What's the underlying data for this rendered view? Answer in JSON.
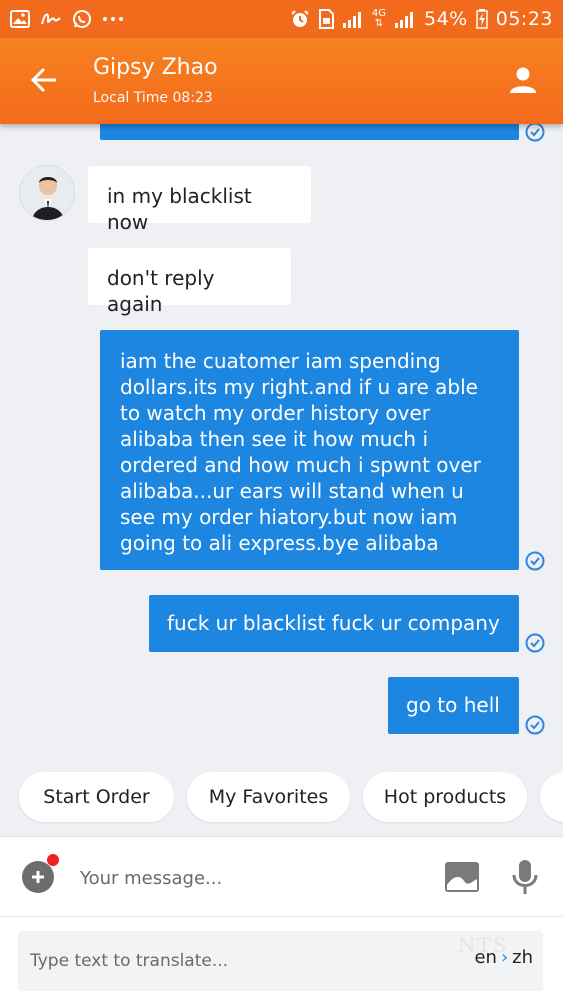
{
  "status_bar": {
    "network": "4G",
    "battery": "54%",
    "time": "05:23"
  },
  "header": {
    "contact_name": "Gipsy Zhao",
    "local_time": "Local Time 08:23"
  },
  "messages": [
    {
      "side": "incoming",
      "text": "in my blacklist now"
    },
    {
      "side": "incoming",
      "text": "don't reply again"
    },
    {
      "side": "outgoing",
      "text": "iam the cuatomer iam spending dollars.its my right.and if u are able to watch my order history over alibaba then see it how much i ordered and how much i spwnt over alibaba...ur ears will stand when u see my order hiatory.but now iam going to ali express.bye alibaba"
    },
    {
      "side": "outgoing",
      "text": "fuck ur blacklist fuck ur company"
    },
    {
      "side": "outgoing",
      "text": "go to hell"
    }
  ],
  "quick_replies": [
    "Start Order",
    "My Favorites",
    "Hot products"
  ],
  "composer": {
    "placeholder": "Your message..."
  },
  "translate": {
    "placeholder": "Type text to translate...",
    "from": "en",
    "to": "zh",
    "watermark": "NTS"
  },
  "colors": {
    "brand_orange": "#f36a1c",
    "outgoing_bubble": "#1d86e0",
    "read_check": "#2f86e0",
    "notification_dot": "#f01f25"
  }
}
